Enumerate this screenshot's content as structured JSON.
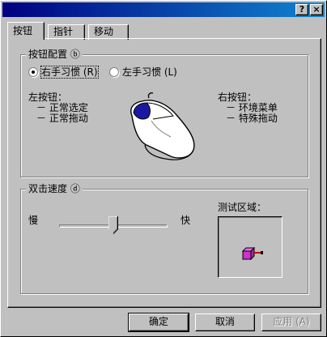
{
  "title_buttons": {
    "help": "?",
    "close": "×"
  },
  "tabs": [
    {
      "label": "按钮",
      "active": true
    },
    {
      "label": "指针",
      "active": false
    },
    {
      "label": "移动",
      "active": false
    }
  ],
  "button_config": {
    "group_title": "按钮配置 ⓑ",
    "right_handed_label": "右手习惯 (R)",
    "left_handed_label": "左手习惯 (L)",
    "selected": "right_handed",
    "left_button_title": "左按钮：",
    "left_button_items": [
      "－ 正常选定",
      "－ 正常拖动"
    ],
    "right_button_title": "右按钮：",
    "right_button_items": [
      "－ 环境菜单",
      "－ 特殊拖动"
    ]
  },
  "double_click": {
    "group_title": "双击速度 ⓓ",
    "slow_label": "慢",
    "fast_label": "快",
    "speed": 0.5,
    "test_area_label": "测试区域："
  },
  "buttons": {
    "ok": "确定",
    "cancel": "取消",
    "apply": "应用 (A)"
  },
  "colors": {
    "face": "#c0c0c0",
    "title_start": "#000080",
    "title_end": "#1084d0",
    "jack_box": "#cc33cc"
  }
}
